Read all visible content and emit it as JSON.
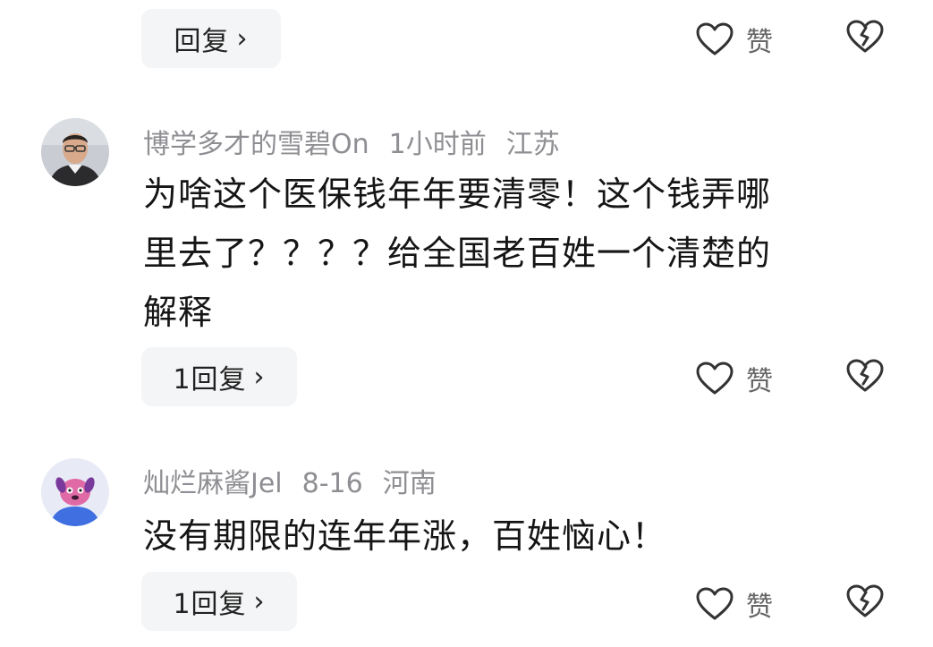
{
  "top_reply": {
    "reply_label": "回复",
    "like_label": "赞"
  },
  "comments": [
    {
      "username": "博学多才的雪碧On",
      "time": "1小时前",
      "location": "江苏",
      "text_lines": [
        "为啥这个医保钱年年要清零！这个钱弄哪",
        "里去了？？？？给全国老百姓一个清楚的",
        "解释"
      ],
      "reply_label": "1回复",
      "like_label": "赞"
    },
    {
      "username": "灿烂麻酱Jel",
      "time": "8-16",
      "location": "河南",
      "text_lines": [
        "没有期限的连年年涨，百姓恼心！"
      ],
      "reply_label": "1回复",
      "like_label": "赞"
    }
  ],
  "icons": {
    "like": "heart-outline-icon",
    "dislike": "broken-heart-icon",
    "chevron": "chevron-right-icon"
  }
}
